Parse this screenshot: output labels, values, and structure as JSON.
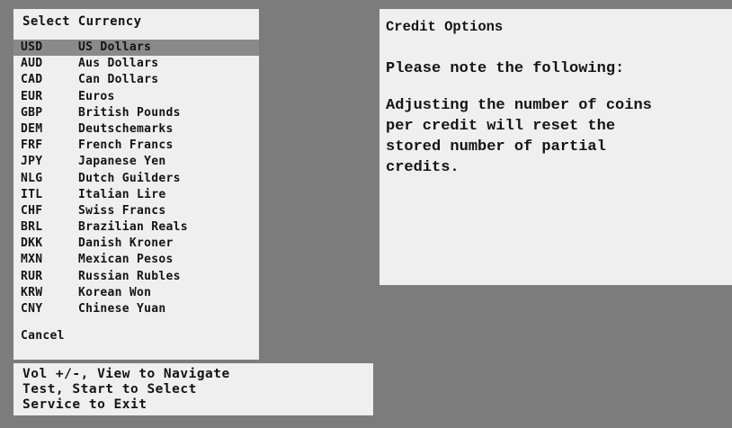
{
  "menu": {
    "title": "Select Currency",
    "items": [
      {
        "code": "USD",
        "name": "US Dollars",
        "selected": true
      },
      {
        "code": "AUD",
        "name": "Aus Dollars"
      },
      {
        "code": "CAD",
        "name": "Can Dollars"
      },
      {
        "code": "EUR",
        "name": "Euros"
      },
      {
        "code": "GBP",
        "name": "British Pounds"
      },
      {
        "code": "DEM",
        "name": "Deutschemarks"
      },
      {
        "code": "FRF",
        "name": "French Francs"
      },
      {
        "code": "JPY",
        "name": "Japanese Yen"
      },
      {
        "code": "NLG",
        "name": "Dutch Guilders"
      },
      {
        "code": "ITL",
        "name": "Italian Lire"
      },
      {
        "code": "CHF",
        "name": "Swiss Francs"
      },
      {
        "code": "BRL",
        "name": "Brazilian Reals"
      },
      {
        "code": "DKK",
        "name": "Danish Kroner"
      },
      {
        "code": "MXN",
        "name": "Mexican Pesos"
      },
      {
        "code": "RUR",
        "name": "Russian Rubles"
      },
      {
        "code": "KRW",
        "name": "Korean Won"
      },
      {
        "code": "CNY",
        "name": "Chinese Yuan"
      }
    ],
    "cancel_label": "Cancel"
  },
  "help": {
    "line1": "Vol +/-, View to Navigate",
    "line2": "Test, Start to Select",
    "line3": "Service to Exit"
  },
  "credit": {
    "title": "Credit Options",
    "note": "Please note the following:",
    "body": "Adjusting the number of coins\nper credit will reset the\nstored number of partial\ncredits."
  },
  "colors": {
    "background": "#7c7c7c",
    "panel": "#efefef",
    "selection": "#8a8a8a",
    "text": "#141414"
  }
}
